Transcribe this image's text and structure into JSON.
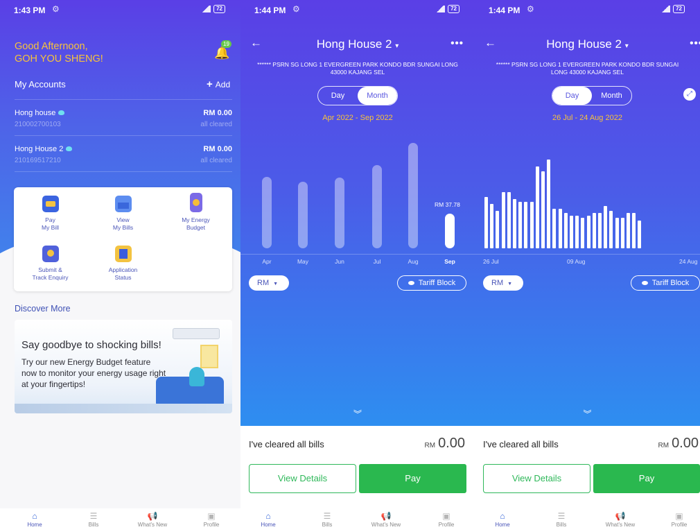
{
  "status": {
    "time1": "1:43 PM",
    "time2": "1:44 PM",
    "time3": "1:44 PM",
    "battery": "72"
  },
  "home": {
    "greeting_line1": "Good Afternoon,",
    "greeting_line2": "GOH YOU SHENG!",
    "notification_count": "19",
    "my_accounts": "My Accounts",
    "add_label": "Add",
    "accounts": [
      {
        "name": "Hong house",
        "number": "210002700103",
        "amount": "RM 0.00",
        "status": "all cleared"
      },
      {
        "name": "Hong House 2",
        "number": "210169517210",
        "amount": "RM 0.00",
        "status": "all cleared"
      }
    ],
    "quick_actions": [
      {
        "line1": "Pay",
        "line2": "My Bill"
      },
      {
        "line1": "View",
        "line2": "My Bills"
      },
      {
        "line1": "My Energy",
        "line2": "Budget"
      },
      {
        "line1": "Submit &",
        "line2": "Track Enquiry"
      },
      {
        "line1": "Application",
        "line2": "Status"
      }
    ],
    "discover_more": "Discover More",
    "banner_heading": "Say goodbye to shocking bills!",
    "banner_text": "Try our new Energy Budget feature now to monitor your energy usage right at your fingertips!"
  },
  "usage": {
    "account_title": "Hong House 2",
    "address": "****** PSRN SG LONG 1 EVERGREEN PARK KONDO BDR SUNGAI LONG 43000 KAJANG SEL",
    "toggle_day": "Day",
    "toggle_month": "Month",
    "monthly_range": "Apr 2022 - Sep 2022",
    "daily_range": "26 Jul - 24 Aug 2022",
    "unit_button": "RM",
    "tariff_button": "Tariff Block",
    "cleared_text": "I've cleared all bills",
    "currency": "RM",
    "balance": "0.00",
    "view_details": "View Details",
    "pay": "Pay"
  },
  "nav": {
    "home": "Home",
    "bills": "Bills",
    "whats_new": "What's New",
    "profile": "Profile"
  },
  "chart_data": [
    {
      "type": "bar",
      "categories": [
        "Apr",
        "May",
        "Jun",
        "Jul",
        "Aug",
        "Sep"
      ],
      "values": [
        78,
        73,
        77,
        91,
        115,
        37.78
      ],
      "current_label": "RM 37.78",
      "highlight_index": 5
    },
    {
      "type": "bar",
      "x_tick_labels": [
        "26 Jul",
        "09 Aug",
        "24 Aug"
      ],
      "values": [
        2.2,
        1.9,
        1.6,
        2.4,
        2.4,
        2.1,
        2.0,
        2.0,
        2.0,
        3.5,
        3.3,
        3.8,
        1.7,
        1.7,
        1.5,
        1.4,
        1.4,
        1.3,
        1.4,
        1.5,
        1.5,
        1.8,
        1.6,
        1.3,
        1.3,
        1.5,
        1.5,
        1.2
      ]
    }
  ]
}
